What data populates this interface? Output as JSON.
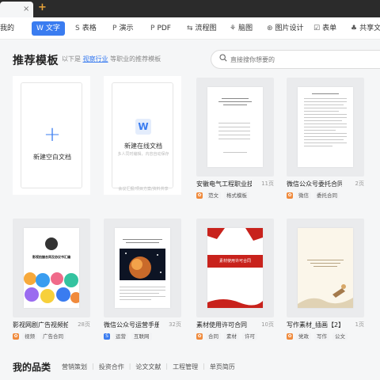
{
  "tabs": {
    "close": "×",
    "add": "+"
  },
  "toolbar": {
    "items": [
      {
        "label": "我的",
        "icon": ""
      },
      {
        "label": "文字",
        "icon": "W"
      },
      {
        "label": "表格",
        "icon": "S"
      },
      {
        "label": "演示",
        "icon": "P"
      },
      {
        "label": "PDF",
        "icon": "P"
      },
      {
        "label": "流程图",
        "icon": "⇆"
      },
      {
        "label": "脑图",
        "icon": "⚘"
      },
      {
        "label": "图片设计",
        "icon": "⊛"
      },
      {
        "label": "表单",
        "icon": "☑"
      },
      {
        "label": "共享文件",
        "icon": "♣"
      }
    ],
    "accent": "#3a7cf0"
  },
  "header": {
    "title": "推荐模板",
    "hint_prefix": "以下是",
    "hint_link": "视察行业",
    "hint_suffix": "等职业的推荐模板",
    "search_placeholder": "直接搜你想要的"
  },
  "blank_doc": {
    "label": "新建空白文档",
    "plus": "+"
  },
  "online_doc": {
    "label": "新建在线文档",
    "icon": "W",
    "sub": "多人同时编辑，内容自动保存",
    "foot": "会议汇报/项目方案/资料共享"
  },
  "templates": [
    {
      "title": "安徽电气工程职业技...",
      "pages": "11页",
      "tags": [
        "范文",
        "格式模板"
      ]
    },
    {
      "title": "微信公众号委托合同",
      "pages": "2页",
      "tags": [
        "微信",
        "委托合同"
      ]
    },
    {
      "title": "影视网剧广告视频拍...",
      "pages": "28页",
      "tags": [
        "视频",
        "广告合同"
      ]
    },
    {
      "title": "微信公众号运营手册",
      "pages": "32页",
      "tags": [
        "运营",
        "互联网"
      ]
    },
    {
      "title": "素材使用许可合同",
      "pages": "10页",
      "tags": [
        "合同",
        "素材",
        "许可"
      ]
    },
    {
      "title": "写作素材_插画【2】",
      "pages": "1页",
      "tags": [
        "党政",
        "写作",
        "公文"
      ]
    }
  ],
  "thumb_text": {
    "t3_title": "影视拍摄合同及协议书汇编",
    "t5_banner": "素材使用许可合同"
  },
  "categories": {
    "title": "我的品类",
    "items": [
      "营销策划",
      "投资合作",
      "论文文献",
      "工程管理",
      "单页简历"
    ]
  }
}
